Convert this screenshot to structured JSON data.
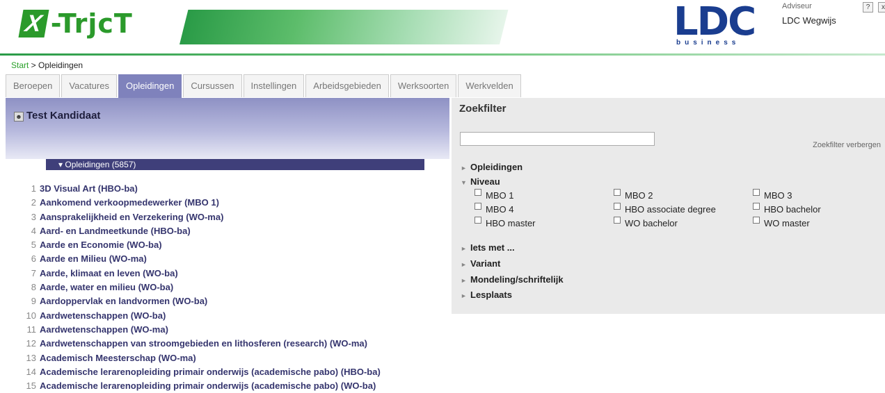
{
  "header": {
    "logo_x": "X",
    "logo_text": "-TrjcT",
    "partner_logo_main": "LDC",
    "partner_logo_sub": "business",
    "advisor_role": "Adviseur",
    "advisor_name": "LDC Wegwijs",
    "help_label": "?",
    "close_label": "x"
  },
  "breadcrumb": {
    "start": "Start",
    "separator": " > ",
    "current": "Opleidingen"
  },
  "tabs": [
    {
      "label": "Beroepen"
    },
    {
      "label": "Vacatures"
    },
    {
      "label": "Opleidingen",
      "active": true
    },
    {
      "label": "Cursussen"
    },
    {
      "label": "Instellingen"
    },
    {
      "label": "Arbeidsgebieden"
    },
    {
      "label": "Werksoorten"
    },
    {
      "label": "Werkvelden"
    }
  ],
  "candidate": {
    "name": "Test Kandidaat"
  },
  "list": {
    "header": "▾ Opleidingen (5857)",
    "items": [
      {
        "num": "1",
        "title": "3D Visual Art (HBO-ba)"
      },
      {
        "num": "2",
        "title": "Aankomend verkoopmedewerker (MBO 1)"
      },
      {
        "num": "3",
        "title": "Aansprakelijkheid en Verzekering (WO-ma)"
      },
      {
        "num": "4",
        "title": "Aard- en Landmeetkunde (HBO-ba)"
      },
      {
        "num": "5",
        "title": "Aarde en Economie (WO-ba)"
      },
      {
        "num": "6",
        "title": "Aarde en Milieu (WO-ma)"
      },
      {
        "num": "7",
        "title": "Aarde, klimaat en leven (WO-ba)"
      },
      {
        "num": "8",
        "title": "Aarde, water en milieu (WO-ba)"
      },
      {
        "num": "9",
        "title": "Aardoppervlak en landvormen (WO-ba)"
      },
      {
        "num": "10",
        "title": "Aardwetenschappen (WO-ba)"
      },
      {
        "num": "11",
        "title": "Aardwetenschappen (WO-ma)"
      },
      {
        "num": "12",
        "title": "Aardwetenschappen van stroomgebieden en lithosferen (research) (WO-ma)"
      },
      {
        "num": "13",
        "title": "Academisch Meesterschap (WO-ma)"
      },
      {
        "num": "14",
        "title": "Academische lerarenopleiding primair onderwijs (academische pabo) (HBO-ba)"
      },
      {
        "num": "15",
        "title": "Academische lerarenopleiding primair onderwijs (academische pabo) (WO-ba)"
      }
    ]
  },
  "filter": {
    "title": "Zoekfilter",
    "search_value": "",
    "hide_label": "Zoekfilter verbergen",
    "sections": {
      "opleidingen": "Opleidingen",
      "niveau": "Niveau",
      "iets_met": "Iets met ...",
      "variant": "Variant",
      "mondeling": "Mondeling/schriftelijk",
      "lesplaats": "Lesplaats"
    },
    "niveau_options": [
      "MBO 1",
      "MBO 2",
      "MBO 3",
      "MBO 4",
      "HBO associate degree",
      "HBO bachelor",
      "HBO master",
      "WO bachelor",
      "WO master"
    ]
  },
  "colors": {
    "brand_green": "#2b9a2b",
    "tab_active": "#7f82bc",
    "list_header": "#3f3f7a",
    "link_text": "#35356e"
  }
}
